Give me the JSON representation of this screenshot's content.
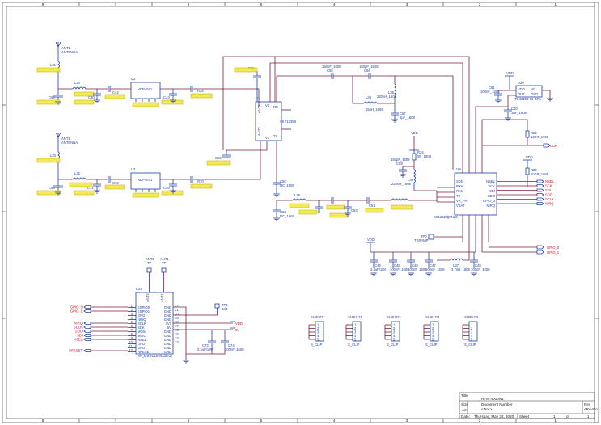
{
  "colors": {
    "wire": "#7a1e3c",
    "part": "#1f3ea8",
    "netlabel": "#cc1111",
    "highlight": "#f2ea57",
    "frame": "#333333",
    "ground": "#1f3ea8"
  },
  "border": {
    "top_numbers": [
      "8",
      "7",
      "6",
      "5",
      "4",
      "3",
      "2",
      "1"
    ],
    "bottom_numbers": [
      "8",
      "7",
      "6",
      "5",
      "4",
      "3",
      "2",
      "1"
    ]
  },
  "antennas": {
    "ant1": {
      "ref": "ANT1",
      "value": "ANTENNA",
      "inductor": "L31",
      "filter_ref": "L30",
      "cap": "C64",
      "cap2": "C30",
      "cap3": "C42",
      "switch_ref": "U2",
      "switch_part": "NDP4071",
      "cap4": "C43",
      "res": "R26"
    },
    "ant2": {
      "ref": "ANT2",
      "value": "ANTENNA",
      "inductor": "L33",
      "filter_ref": "L32",
      "cap": "C65",
      "cap2": "C71",
      "cap3": "C72",
      "switch_ref": "U3",
      "switch_part": "NDP4071",
      "cap4": "C46",
      "res": "R70"
    }
  },
  "rf_switch": {
    "ref": "U1",
    "part": "SKY13350",
    "pins": [
      "ANT1",
      "ANT2",
      "RX",
      "TX",
      "V1",
      "V2"
    ],
    "cap_ref": "C62",
    "cap_ref2": "C63"
  },
  "top_caps": [
    {
      "ref": "C55",
      "value": "150pF_1608"
    },
    {
      "ref": "C56",
      "value": "150pF_1608"
    }
  ],
  "inductors_mid": [
    {
      "ref": "L35",
      "value": "220nH_1608"
    },
    {
      "ref": "L34",
      "value": "15nH_1608"
    },
    {
      "ref": "L36",
      "value": "220nH_1608"
    }
  ],
  "mid_parts": [
    {
      "ref": "C57",
      "value": "6pF_1608"
    },
    {
      "ref": "C58",
      "value": "150pF_1608"
    },
    {
      "ref": "R24",
      "value": "0R_1608"
    },
    {
      "ref": "C50",
      "value": "NC_1608"
    },
    {
      "ref": "C52",
      "value": "NC_1608"
    },
    {
      "ref": "C51",
      "value": ""
    },
    {
      "ref": "C53",
      "value": ""
    }
  ],
  "regulator": {
    "ref": "U20",
    "part": "TSX3250-33-BPA",
    "pins": [
      "VDD",
      "OUT",
      "GND",
      "NC"
    ],
    "vdd": "VDD",
    "c_in": {
      "ref": "C61",
      "value": "100nF_1608"
    },
    "c_out": {
      "ref": "C60",
      "value": "1uF_1608"
    }
  },
  "resistors_right": [
    {
      "ref": "R25",
      "value": "10KR_1608"
    },
    {
      "ref": "R23",
      "value": "10KR_1608"
    }
  ],
  "transceiver": {
    "ref": "U19",
    "part": "SX1262/QFN20",
    "left_pins": [
      "SDN",
      "RXe",
      "RXn",
      "TX",
      "VR_PA",
      "VBAT"
    ],
    "right_pins": [
      "NSEL",
      "SCK",
      "SDI",
      "SDO",
      "GPIO_3",
      "NIRQ"
    ],
    "top_pins": [
      "GPIO_1",
      "GPIO_0",
      "XTAL",
      "XOUT",
      "GND"
    ],
    "bottom_pins": [
      "VDD",
      "GND",
      "GND",
      "VDD"
    ]
  },
  "net_labels_right": [
    "CON",
    "NSEL",
    "SCK",
    "SDI",
    "SDO",
    "SCLK",
    "NIRQ"
  ],
  "gpio_labels": [
    "GPIO_0",
    "GPIO_1"
  ],
  "crystal": {
    "ref": "TP0",
    "value": "TXRAMP"
  },
  "decoupling": {
    "vdd": "VDD",
    "caps": [
      {
        "ref": "C43",
        "value": "2.2uF/10V"
      },
      {
        "ref": "C45",
        "value": "100nF_1608"
      },
      {
        "ref": "C46",
        "value": "100nF_1608"
      },
      {
        "ref": "C47",
        "value": "100nF_1608"
      },
      {
        "ref": "C48",
        "value": "100nF_1608"
      }
    ],
    "inductor": {
      "ref": "L37",
      "value": "4.7nH_1608"
    }
  },
  "test_points": [
    {
      "ref": "ANT2",
      "type": "TP"
    },
    {
      "ref": "ANT1",
      "type": "TP"
    }
  ],
  "module": {
    "ref": "U24",
    "part": "RF_MODULE(GuideU)",
    "left_pins": [
      "ESPIO0",
      "ESPIO1",
      "GND",
      "NIRQ",
      "SCLK",
      "SCK",
      "MOSI",
      "MISO",
      "NSEL",
      "GND",
      "GND",
      "NRESET"
    ],
    "left_nums": [
      "1",
      "2",
      "3",
      "4",
      "5",
      "6",
      "7",
      "8",
      "9",
      "10",
      "11",
      "12"
    ],
    "right_pins": [
      "GND",
      "GND",
      "GND",
      "GND",
      "3V3",
      "5V",
      "GND",
      "GND",
      "GND",
      "GND",
      "GND",
      "GND"
    ],
    "right_nums": [
      "22",
      "21",
      "20",
      "19",
      "18",
      "17",
      "16",
      "15",
      "14",
      "13",
      "",
      ""
    ],
    "top_pins": [
      "ANT2",
      "ANT1"
    ],
    "nets_left": [
      "GPIO_0",
      "GPIO_1",
      "NIRQ",
      "SCLK",
      "SDO",
      "SDI",
      "NSEL",
      "NRESET"
    ],
    "nets_right": [
      "VDD",
      "5V"
    ],
    "caps": [
      {
        "ref": "C73",
        "value": "2.2uF/10V"
      },
      {
        "ref": "C74",
        "value": "100nF_1608"
      }
    ],
    "tp": {
      "ref": "TP1",
      "value": "3dB"
    }
  },
  "shields": [
    {
      "ref": "SHIELD1",
      "value": "S_CLIP"
    },
    {
      "ref": "SHIELD2",
      "value": "S_CLIP"
    },
    {
      "ref": "SHIELD3",
      "value": "S_CLIP"
    },
    {
      "ref": "SHIELD4",
      "value": "S_CLIP"
    },
    {
      "ref": "SHIELD5",
      "value": "S_CLIP"
    }
  ],
  "title_block": {
    "title_label": "Title",
    "title": "RFM-4000N1",
    "size_label": "Size",
    "size": "A3",
    "doc_label": "Document Number",
    "doc": "<Doc>",
    "rev_label": "Rev",
    "rev": "<RevCo",
    "date_label": "Date:",
    "date": "Thursday, May 28, 2020",
    "sheet_label": "Sheet",
    "sheet": "1",
    "of_label": "of",
    "of": "1"
  }
}
